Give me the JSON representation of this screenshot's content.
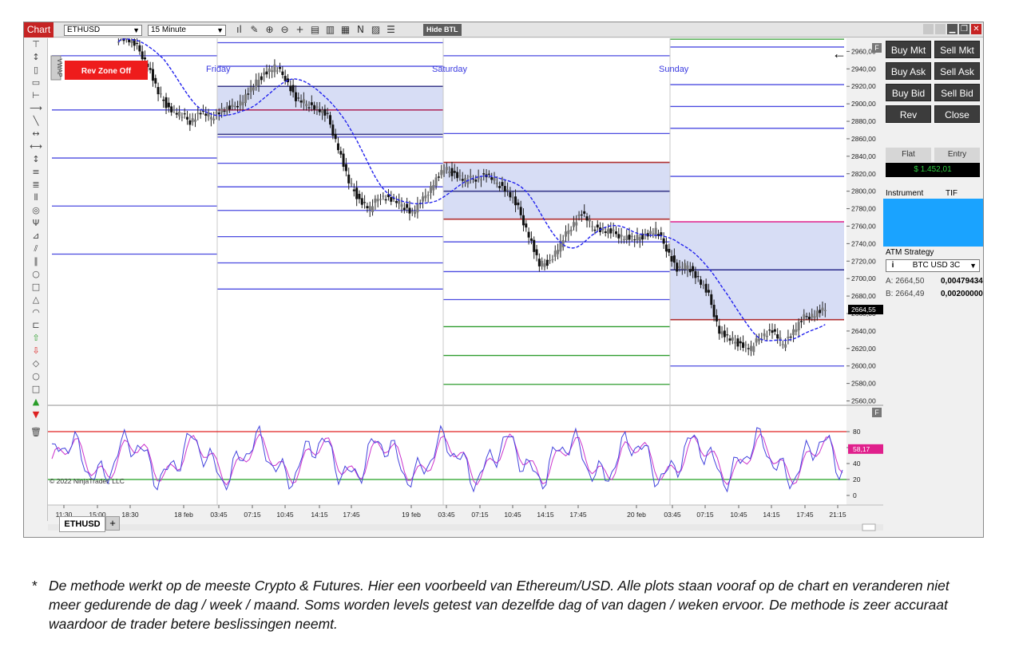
{
  "window": {
    "tab_label": "Chart",
    "instrument": "ETHUSD",
    "interval": "15 Minute",
    "hide_btl": "Hide BTL"
  },
  "chart": {
    "rev_zone": "Rev Zone Off",
    "vwap_label": "VWAP",
    "session_labels": [
      "Friday",
      "Saturday",
      "Sunday"
    ],
    "price_ticks": [
      "2960,00",
      "2940,00",
      "2920,00",
      "2900,00",
      "2880,00",
      "2860,00",
      "2840,00",
      "2820,00",
      "2800,00",
      "2780,00",
      "2760,00",
      "2740,00",
      "2720,00",
      "2700,00",
      "2680,00",
      "2660,00",
      "2640,00",
      "2620,00",
      "2600,00",
      "2580,00",
      "2560,00"
    ],
    "current_price": "2664,55",
    "indicator_ticks": [
      "80",
      "60",
      "40",
      "20",
      "0"
    ],
    "indicator_value": "58,17",
    "copyright": "© 2022 NinjaTrader, LLC",
    "time_ticks": [
      "11:30",
      "15:00",
      "18:30",
      "18 feb",
      "03:45",
      "07:15",
      "10:45",
      "14:15",
      "17:45",
      "19 feb",
      "03:45",
      "07:15",
      "10:45",
      "14:15",
      "17:45",
      "20 feb",
      "03:45",
      "07:15",
      "10:45",
      "14:15",
      "17:45",
      "21:15"
    ],
    "bottom_tab": "ETHUSD",
    "add_tab": "+"
  },
  "chart_data": {
    "type": "candlestick",
    "title": "",
    "ylim": [
      2555,
      2975
    ],
    "close_series": [
      2975,
      2965,
      2945,
      2912,
      2895,
      2888,
      2880,
      2890,
      2885,
      2893,
      2895,
      2905,
      2920,
      2935,
      2942,
      2930,
      2905,
      2900,
      2895,
      2885,
      2850,
      2810,
      2790,
      2780,
      2795,
      2790,
      2785,
      2775,
      2790,
      2810,
      2825,
      2820,
      2812,
      2815,
      2818,
      2810,
      2800,
      2780,
      2750,
      2715,
      2720,
      2740,
      2760,
      2775,
      2760,
      2755,
      2752,
      2748,
      2745,
      2750,
      2755,
      2735,
      2710,
      2715,
      2700,
      2680,
      2640,
      2630,
      2625,
      2620,
      2635,
      2640,
      2625,
      2640,
      2655,
      2660,
      2665
    ],
    "levels_friday": [
      2920,
      2893,
      2865
    ],
    "levels_saturday": [
      2833,
      2800,
      2768
    ],
    "levels_sunday": [
      2765,
      2710,
      2653
    ],
    "indicator": {
      "upper": 80,
      "lower": 20,
      "last": 58.17
    }
  },
  "trade_panel": {
    "buy_mkt": "Buy Mkt",
    "sell_mkt": "Sell Mkt",
    "buy_ask": "Buy Ask",
    "sell_ask": "Sell Ask",
    "buy_bid": "Buy Bid",
    "sell_bid": "Sell Bid",
    "rev": "Rev",
    "close": "Close",
    "flat": "Flat",
    "entry": "Entry",
    "pnl": "$ 1.452,01",
    "instrument_label": "Instrument",
    "tif_label": "TIF",
    "atm_label": "ATM Strategy",
    "atm_value": "BTC USD 3C",
    "ask_label": "A:",
    "ask_price": "2664,50",
    "ask_qty": "0,00479434",
    "bid_label": "B:",
    "bid_price": "2664,49",
    "bid_qty": "0,00200000"
  },
  "caption": {
    "star": "*",
    "text": "De methode werkt op de meeste Crypto & Futures. Hier een voorbeeld van Ethereum/USD. Alle plots staan vooraf op de chart en veranderen niet meer gedurende de dag / week / maand. Soms worden levels getest van dezelfde dag of van dagen / weken ervoor. De methode is zeer accuraat waardoor de trader betere beslissingen neemt."
  }
}
